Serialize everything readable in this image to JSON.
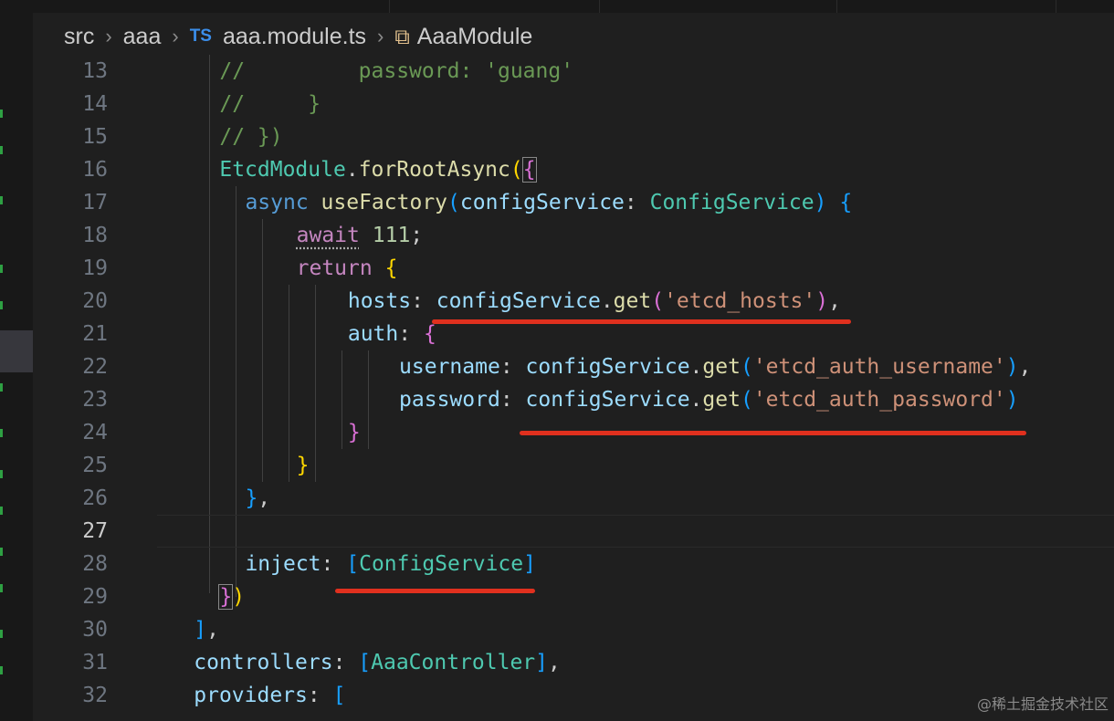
{
  "breadcrumb": {
    "folder1": "src",
    "folder2": "aaa",
    "file_badge": "TS",
    "file": "aaa.module.ts",
    "symbol": "AaaModule"
  },
  "editor": {
    "active_line": "27",
    "lines": [
      {
        "n": "13",
        "t": "//         password: 'guang'"
      },
      {
        "n": "14",
        "t": "//     }"
      },
      {
        "n": "15",
        "t": "// })"
      },
      {
        "n": "16",
        "t": "EtcdModule.forRootAsync({"
      },
      {
        "n": "17",
        "t": "async useFactory(configService: ConfigService) {"
      },
      {
        "n": "18",
        "t": "await 111;"
      },
      {
        "n": "19",
        "t": "return {"
      },
      {
        "n": "20",
        "t": "hosts: configService.get('etcd_hosts'),"
      },
      {
        "n": "21",
        "t": "auth: {"
      },
      {
        "n": "22",
        "t": "username: configService.get('etcd_auth_username'),"
      },
      {
        "n": "23",
        "t": "password: configService.get('etcd_auth_password')"
      },
      {
        "n": "24",
        "t": "}"
      },
      {
        "n": "25",
        "t": "}"
      },
      {
        "n": "26",
        "t": "},"
      },
      {
        "n": "27",
        "t": ""
      },
      {
        "n": "28",
        "t": "inject: [ConfigService]"
      },
      {
        "n": "29",
        "t": "})"
      },
      {
        "n": "30",
        "t": "],"
      },
      {
        "n": "31",
        "t": "controllers: [AaaController],"
      },
      {
        "n": "32",
        "t": "providers: ["
      }
    ]
  },
  "watermark": "@稀土掘金技术社区",
  "colors": {
    "background": "#1f1f1f",
    "comment": "#6a9955",
    "keyword": "#c586c0",
    "function": "#dcdcaa",
    "variable": "#9cdcfe",
    "type": "#4ec9b0",
    "string": "#ce9178",
    "annotation_underline": "#e0301e"
  }
}
